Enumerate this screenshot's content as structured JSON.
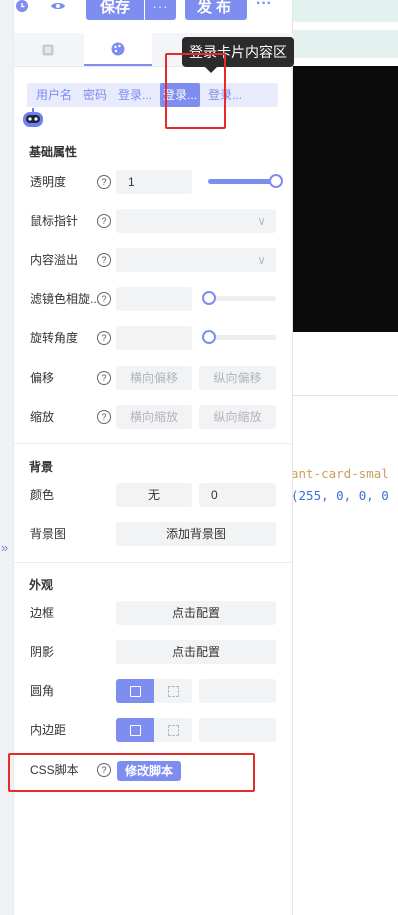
{
  "toolbar": {
    "save_label": "保存",
    "more_label": "···",
    "publish_label": "发布",
    "menu_label": "···",
    "history_icon": "clock-icon",
    "preview_icon": "eye-icon"
  },
  "panel_tabs": [
    {
      "icon": "list-icon",
      "active": false
    },
    {
      "icon": "palette-icon",
      "active": true
    }
  ],
  "subtabs": [
    "用户名",
    "密码",
    "登录...",
    "登录...",
    "登录..."
  ],
  "tooltip": "登录卡片内容区",
  "sections": {
    "basic": "基础属性",
    "background": "背景",
    "appearance": "外观"
  },
  "properties": {
    "opacity": {
      "label": "透明度",
      "value": "1",
      "slider": 1.0
    },
    "cursor": {
      "label": "鼠标指针",
      "value": ""
    },
    "overflow": {
      "label": "内容溢出",
      "value": ""
    },
    "hue": {
      "label": "滤镜色相旋...",
      "value": "",
      "slider": 0.0
    },
    "rotate": {
      "label": "旋转角度",
      "value": "",
      "slider": 0.0
    },
    "offset": {
      "label": "偏移",
      "x_placeholder": "横向偏移",
      "y_placeholder": "纵向偏移"
    },
    "scale": {
      "label": "缩放",
      "x_placeholder": "横向缩放",
      "y_placeholder": "纵向缩放"
    }
  },
  "background": {
    "color_label": "颜色",
    "color_value": "无",
    "color_alpha": "0",
    "image_label": "背景图",
    "image_button": "添加背景图"
  },
  "appearance": {
    "border_label": "边框",
    "border_button": "点击配置",
    "shadow_label": "阴影",
    "shadow_button": "点击配置",
    "radius_label": "圆角",
    "padding_label": "内边距",
    "css_label": "CSS脚本",
    "css_button": "修改脚本"
  },
  "canvas_code": {
    "line1": "ant-card-smal",
    "line2": "(255, 0, 0, 0"
  },
  "colors": {
    "accent": "#7e8df0",
    "highlight_border": "#e62b2b"
  }
}
